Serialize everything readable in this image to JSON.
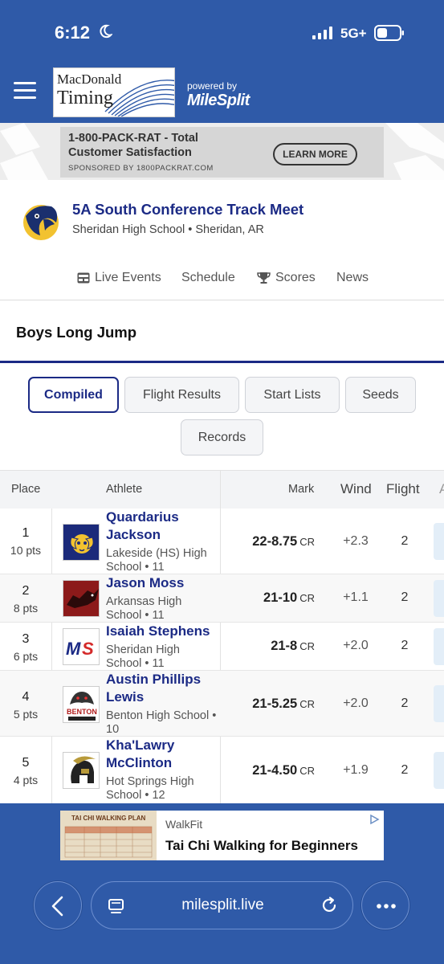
{
  "status_bar": {
    "time": "6:12",
    "network": "5G+"
  },
  "header": {
    "logo_line1": "MacDonald",
    "logo_line2": "Timing",
    "powered_by": "powered by",
    "brand": "MileSplit"
  },
  "top_ad": {
    "headline": "1-800-PACK-RAT - Total Customer Satisfaction",
    "cta": "LEARN MORE",
    "sponsor": "SPONSORED BY 1800PACKRAT.COM"
  },
  "meet": {
    "title": "5A South Conference Track Meet",
    "location": "Sheridan High School • Sheridan, AR"
  },
  "nav": {
    "live_events": "Live Events",
    "schedule": "Schedule",
    "scores": "Scores",
    "news": "News"
  },
  "event": {
    "title": "Boys Long Jump"
  },
  "tabs": {
    "compiled": "Compiled",
    "flight_results": "Flight Results",
    "start_lists": "Start Lists",
    "seeds": "Seeds",
    "records": "Records"
  },
  "table": {
    "headers": {
      "place": "Place",
      "athlete": "Athlete",
      "mark": "Mark",
      "wind": "Wind",
      "flight": "Flight",
      "action": "A"
    },
    "rows": [
      {
        "place": "1",
        "points": "10 pts",
        "name": "Quardarius Jackson",
        "school": "Lakeside (HS) High School • 11",
        "mark": "22-8.75",
        "record": "CR",
        "wind": "+2.3",
        "flight": "2"
      },
      {
        "place": "2",
        "points": "8 pts",
        "name": "Jason Moss",
        "school": "Arkansas High School • 11",
        "mark": "21-10",
        "record": "CR",
        "wind": "+1.1",
        "flight": "2"
      },
      {
        "place": "3",
        "points": "6 pts",
        "name": "Isaiah Stephens",
        "school": "Sheridan High School • 11",
        "mark": "21-8",
        "record": "CR",
        "wind": "+2.0",
        "flight": "2"
      },
      {
        "place": "4",
        "points": "5 pts",
        "name": "Austin Phillips Lewis",
        "school": "Benton High School • 10",
        "mark": "21-5.25",
        "record": "CR",
        "wind": "+2.0",
        "flight": "2"
      },
      {
        "place": "5",
        "points": "4 pts",
        "name": "Kha'Lawry McClinton",
        "school": "Hot Springs High School • 12",
        "mark": "21-4.50",
        "record": "CR",
        "wind": "+1.9",
        "flight": "2"
      }
    ]
  },
  "bottom_ad": {
    "thumb_title": "TAI CHI WALKING PLAN",
    "brand": "WalkFit",
    "title": "Tai Chi Walking for Beginners"
  },
  "browser": {
    "url": "milesplit.live"
  },
  "colors": {
    "header_blue": "#2f5aa8",
    "navy": "#1b2a85"
  },
  "icons": [
    "moon-icon",
    "signal-icon",
    "battery-icon",
    "menu-icon",
    "live-events-icon",
    "trophy-icon",
    "back-icon",
    "tabs-icon",
    "reload-icon",
    "more-icon",
    "adchoices-icon"
  ]
}
